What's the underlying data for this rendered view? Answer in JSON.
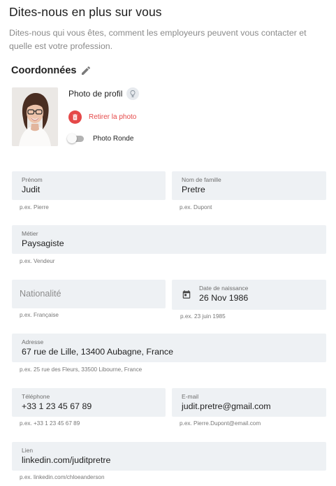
{
  "header": {
    "title": "Dites-nous en plus sur vous",
    "subtitle": "Dites-nous qui vous êtes, comment les employeurs peuvent vous contacter et quelle est votre profession."
  },
  "section": {
    "title": "Coordonnées"
  },
  "photo": {
    "label": "Photo de profil",
    "remove_label": "Retirer la photo",
    "round_label": "Photo Ronde",
    "round_enabled": false
  },
  "fields": {
    "prenom": {
      "label": "Prénom",
      "value": "Judit",
      "hint": "p.ex. Pierre"
    },
    "nom": {
      "label": "Nom de famille",
      "value": "Pretre",
      "hint": "p.ex. Dupont"
    },
    "metier": {
      "label": "Métier",
      "value": "Paysagiste",
      "hint": "p.ex. Vendeur"
    },
    "nationalite": {
      "placeholder": "Nationalité",
      "hint": "p.ex. Française"
    },
    "naissance": {
      "label": "Date de naissance",
      "value": "26 Nov 1986",
      "hint": "p.ex. 23 juin 1985"
    },
    "adresse": {
      "label": "Adresse",
      "value": "67 rue de Lille, 13400 Aubagne, France",
      "hint": "p.ex. 25 rue des Fleurs, 33500 Libourne, France"
    },
    "telephone": {
      "label": "Téléphone",
      "value": "+33 1 23 45 67 89",
      "hint": "p.ex. +33 1 23 45 67 89"
    },
    "email": {
      "label": "E-mail",
      "value": "judit.pretre@gmail.com",
      "hint": "p.ex. Pierre.Dupont@email.com"
    },
    "lien": {
      "label": "Lien",
      "value": "linkedin.com/juditpretre",
      "hint": "p.ex. linkedin.com/chloeanderson"
    }
  },
  "colors": {
    "accent_danger": "#e54848",
    "field_background": "#eef1f4",
    "hint_text": "#777777"
  },
  "icons": {
    "edit": "pencil-icon",
    "tip": "lightbulb-icon",
    "remove": "trash-icon",
    "date": "calendar-icon"
  }
}
